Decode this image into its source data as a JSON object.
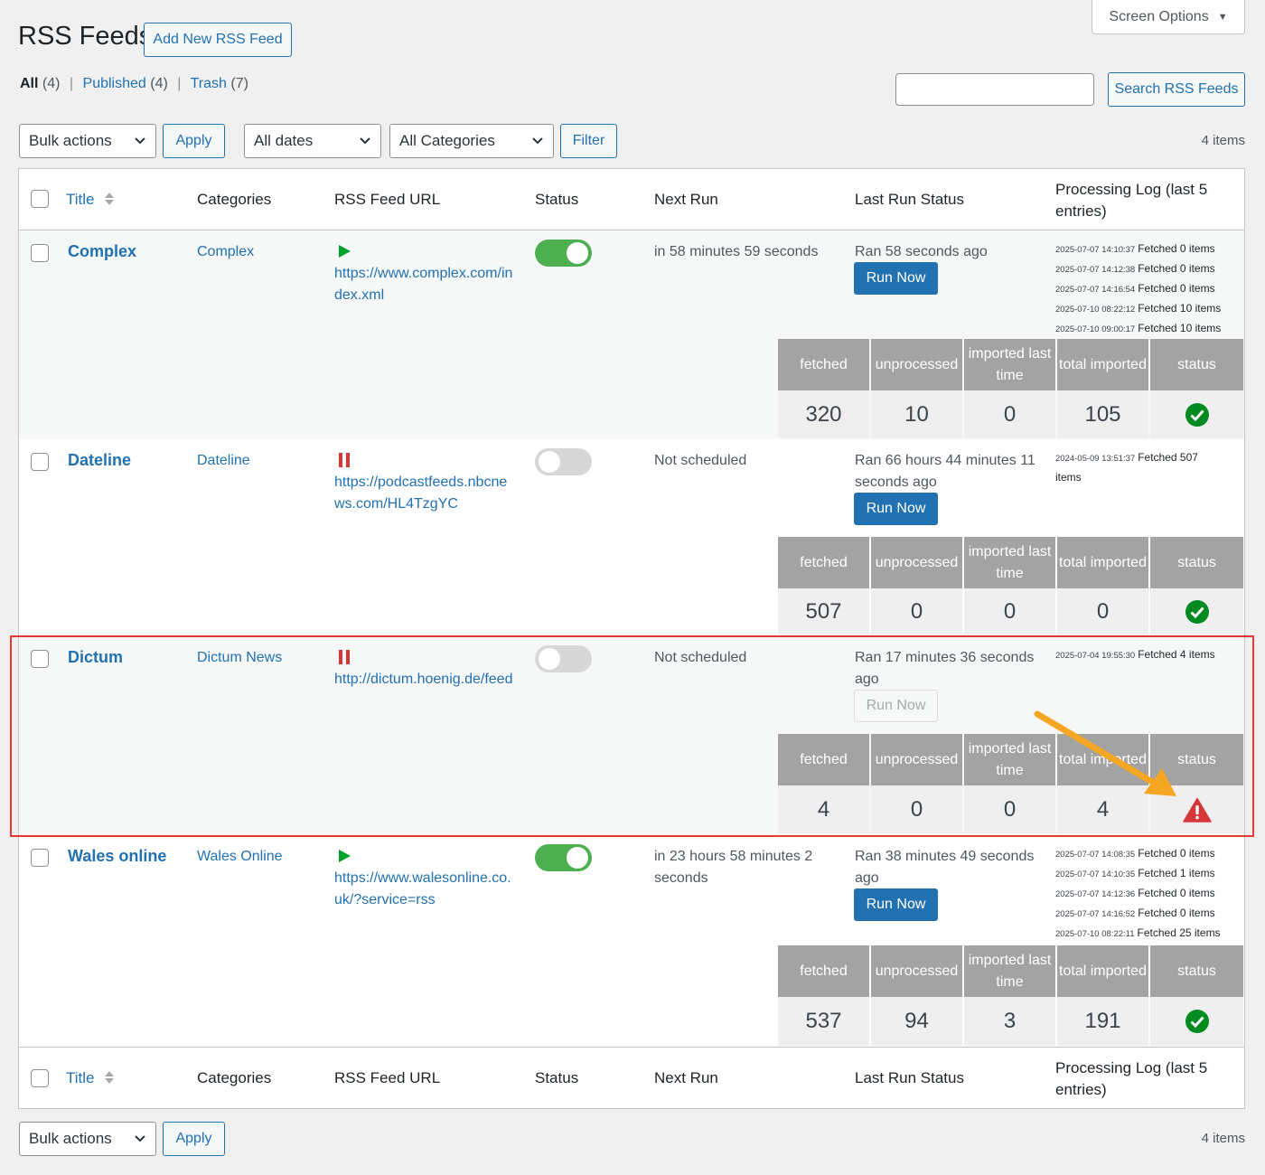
{
  "page": {
    "title": "RSS Feeds",
    "add_new_label": "Add New RSS Feed",
    "screen_options_label": "Screen Options",
    "search_button_label": "Search RSS Feeds",
    "search_value": "",
    "items_count": "4 items"
  },
  "views": {
    "all_label": "All",
    "all_count": "(4)",
    "published_label": "Published",
    "published_count": "(4)",
    "trash_label": "Trash",
    "trash_count": "(7)",
    "separator": "|"
  },
  "filters": {
    "bulk_actions": "Bulk actions",
    "apply": "Apply",
    "dates": "All dates",
    "categories": "All Categories",
    "filter": "Filter"
  },
  "columns": {
    "title": "Title",
    "categories": "Categories",
    "url": "RSS Feed URL",
    "status": "Status",
    "next_run": "Next Run",
    "last_run": "Last Run Status",
    "log": "Processing Log (last 5 entries)"
  },
  "stats_headers": {
    "fetched": "fetched",
    "unprocessed": "unprocessed",
    "imported_last": "imported last time",
    "total_imported": "total imported",
    "status": "status"
  },
  "run_now_label": "Run Now",
  "colors": {
    "accent": "#2271b1",
    "toggle_on": "#4caf50",
    "toggle_off": "#d7d7d7",
    "play": "#00a32a",
    "pause": "#d63638",
    "success": "#008a20",
    "error": "#d63638",
    "highlight": "#e53935",
    "arrow": "#f5a623"
  },
  "feeds": [
    {
      "title": "Complex",
      "category": "Complex",
      "url": "https://www.complex.com/index.xml",
      "state_icon": "play-icon",
      "enabled": true,
      "next_run": "in 58 minutes 59 seconds",
      "last_run": "Ran 58 seconds ago",
      "run_now_enabled": true,
      "log": [
        {
          "ts": "2025-07-07 14:10:37",
          "msg": "Fetched 0 items"
        },
        {
          "ts": "2025-07-07 14:12:38",
          "msg": "Fetched 0 items"
        },
        {
          "ts": "2025-07-07 14:16:54",
          "msg": "Fetched 0 items"
        },
        {
          "ts": "2025-07-10 08:22:12",
          "msg": "Fetched 10 items"
        },
        {
          "ts": "2025-07-10 09:00:17",
          "msg": "Fetched 10 items"
        }
      ],
      "stats": {
        "fetched": "320",
        "unprocessed": "10",
        "imported_last": "0",
        "total_imported": "105",
        "status": "ok"
      }
    },
    {
      "title": "Dateline",
      "category": "Dateline",
      "url": "https://podcastfeeds.nbcnews.com/HL4TzgYC",
      "state_icon": "pause-icon",
      "enabled": false,
      "next_run": "Not scheduled",
      "last_run": "Ran 66 hours 44 minutes 11 seconds ago",
      "run_now_enabled": true,
      "log": [
        {
          "ts": "2024-05-09 13:51:37",
          "msg": "Fetched 507 items"
        }
      ],
      "stats": {
        "fetched": "507",
        "unprocessed": "0",
        "imported_last": "0",
        "total_imported": "0",
        "status": "ok"
      }
    },
    {
      "title": "Dictum",
      "category": "Dictum News",
      "url": "http://dictum.hoenig.de/feed",
      "state_icon": "pause-icon",
      "enabled": false,
      "next_run": "Not scheduled",
      "last_run": "Ran 17 minutes 36 seconds ago",
      "run_now_enabled": false,
      "log": [
        {
          "ts": "2025-07-04 19:55:30",
          "msg": "Fetched 4 items"
        }
      ],
      "stats": {
        "fetched": "4",
        "unprocessed": "0",
        "imported_last": "0",
        "total_imported": "4",
        "status": "error"
      }
    },
    {
      "title": "Wales online",
      "category": "Wales Online",
      "url": "https://www.walesonline.co.uk/?service=rss",
      "state_icon": "play-icon",
      "enabled": true,
      "next_run": "in 23 hours 58 minutes 2 seconds",
      "last_run": "Ran 38 minutes 49 seconds ago",
      "run_now_enabled": true,
      "log": [
        {
          "ts": "2025-07-07 14:08:35",
          "msg": "Fetched 0 items"
        },
        {
          "ts": "2025-07-07 14:10:35",
          "msg": "Fetched 1 items"
        },
        {
          "ts": "2025-07-07 14:12:36",
          "msg": "Fetched 0 items"
        },
        {
          "ts": "2025-07-07 14:16:52",
          "msg": "Fetched 0 items"
        },
        {
          "ts": "2025-07-10 08:22:11",
          "msg": "Fetched 25 items"
        }
      ],
      "stats": {
        "fetched": "537",
        "unprocessed": "94",
        "imported_last": "3",
        "total_imported": "191",
        "status": "ok"
      }
    }
  ]
}
